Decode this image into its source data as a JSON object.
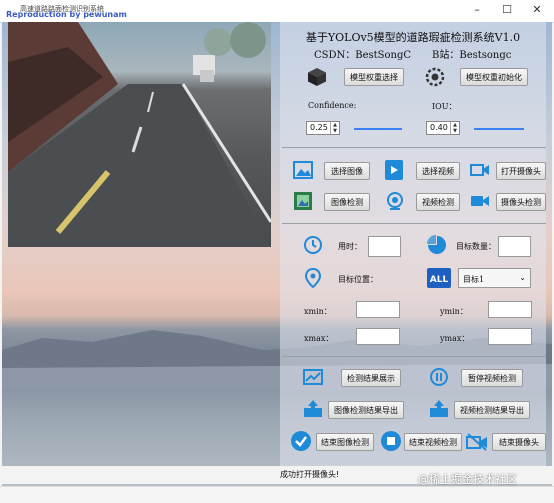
{
  "window": {
    "title": "高速道路路面检测识别系统",
    "overlay_label": "Reproduction by pewunam"
  },
  "header": {
    "title": "基于YOLOv5模型的道路瑕疵检测系统V1.0",
    "csdn": "CSDN：BestSongC",
    "bili": "B站：Bestsongc"
  },
  "model": {
    "select_label": "模型权重选择",
    "init_label": "模型权重初始化"
  },
  "params": {
    "confidence_label": "Confidence:",
    "confidence_value": "0.25",
    "iou_label": "IOU：",
    "iou_value": "0.40"
  },
  "inputs": {
    "select_image": "选择图像",
    "select_video": "选择视频",
    "open_camera": "打开摄像头",
    "detect_image": "图像检测",
    "detect_video": "视频检测",
    "detect_camera": "摄像头检测"
  },
  "results": {
    "time_label": "用时：",
    "count_label": "目标数量：",
    "position_label": "目标位置：",
    "target_option": "目标1",
    "xmin_label": "xmin：",
    "ymin_label": "ymin：",
    "xmax_label": "xmax：",
    "ymax_label": "ymax："
  },
  "actions": {
    "show_results": "检测结果展示",
    "pause_video": "暂停视频检测",
    "export_image": "图像检测结果导出",
    "export_video": "视频检测结果导出",
    "end_image": "结束图像检测",
    "end_video": "结束视频检测",
    "end_camera": "结束摄像头"
  },
  "status": {
    "message": "成功打开摄像头!"
  },
  "watermark": "@稀土掘金技术社区",
  "colors": {
    "accent": "#1f8ad8",
    "slider": "#3b82f6"
  }
}
